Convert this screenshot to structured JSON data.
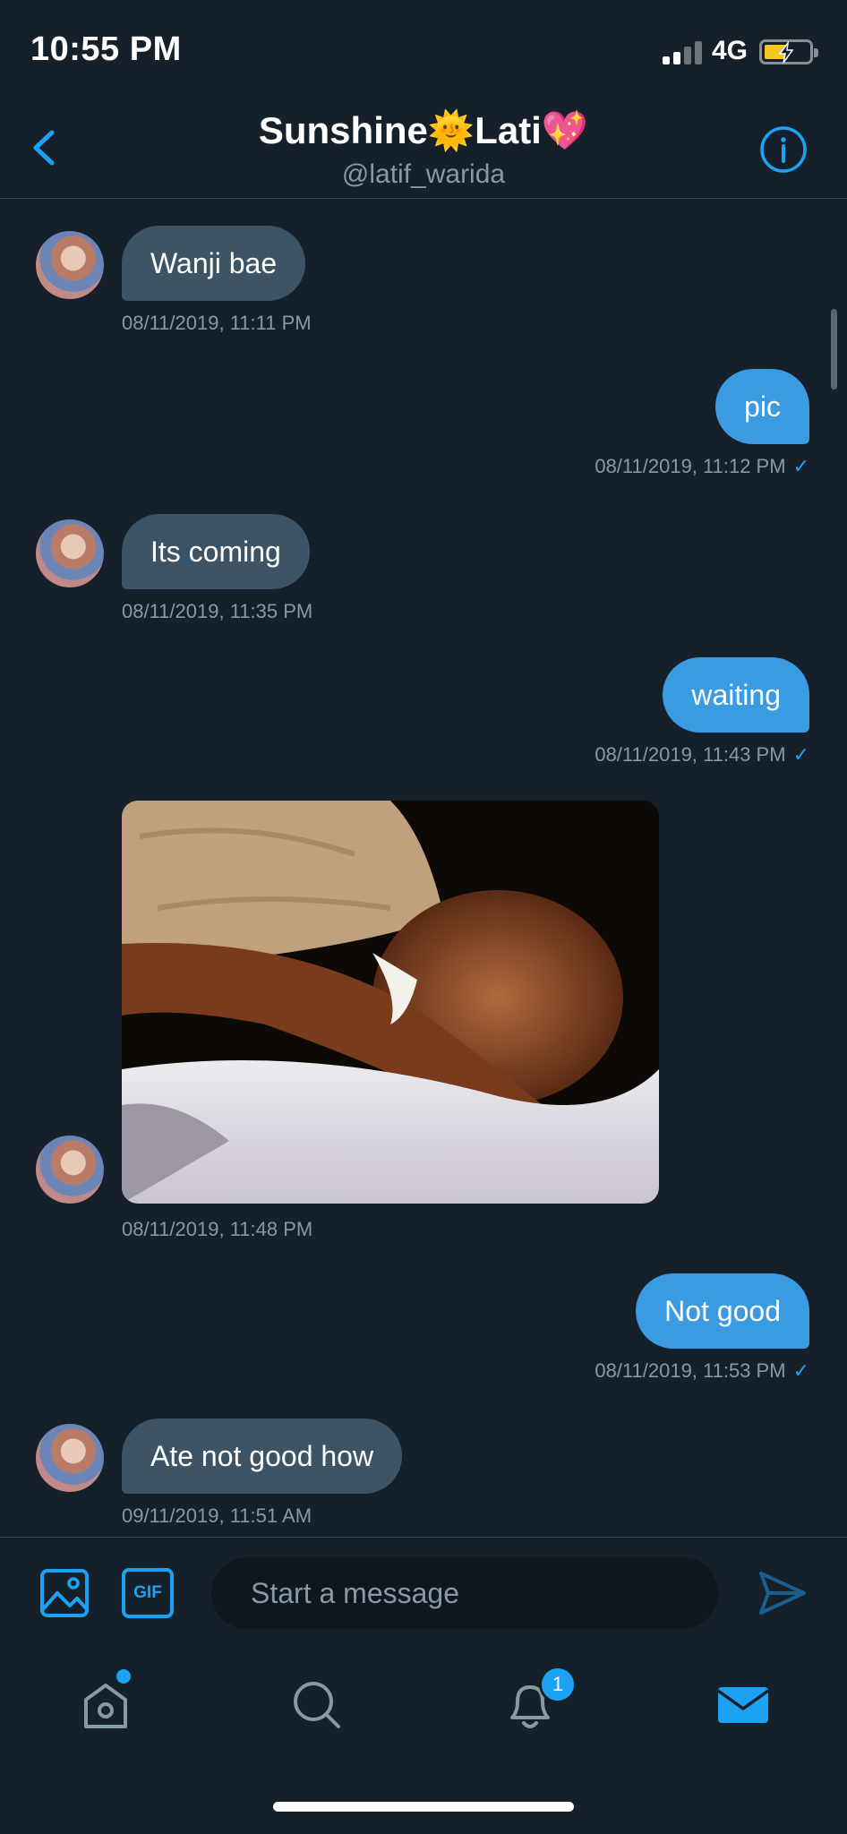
{
  "status_bar": {
    "time": "10:55 PM",
    "network": "4G"
  },
  "header": {
    "name": "Sunshine🌞Lati💖",
    "handle": "@latif_warida"
  },
  "messages": [
    {
      "direction": "in",
      "text": "Wanji bae",
      "time": "08/11/2019, 11:11 PM"
    },
    {
      "direction": "out",
      "text": "pic",
      "time": "08/11/2019, 11:12 PM"
    },
    {
      "direction": "in",
      "text": "Its coming",
      "time": "08/11/2019, 11:35 PM"
    },
    {
      "direction": "out",
      "text": "waiting",
      "time": "08/11/2019, 11:43 PM"
    },
    {
      "direction": "in",
      "type": "image",
      "time": "08/11/2019, 11:48 PM"
    },
    {
      "direction": "out",
      "text": "Not good",
      "time": "08/11/2019, 11:53 PM"
    },
    {
      "direction": "in",
      "text": "Ate not good how",
      "time": "09/11/2019, 11:51 AM"
    }
  ],
  "composer": {
    "placeholder": "Start a message",
    "gif_label": "GIF"
  },
  "tabbar": {
    "notifications_badge": "1"
  },
  "colors": {
    "background": "#15202b",
    "accent": "#1da1f2",
    "incoming_bubble": "#3d5466",
    "muted_text": "#8899a6"
  },
  "icons": [
    "back-chevron-icon",
    "info-icon",
    "image-icon",
    "gif-icon",
    "send-icon",
    "home-icon",
    "search-icon",
    "bell-icon",
    "mail-icon"
  ]
}
